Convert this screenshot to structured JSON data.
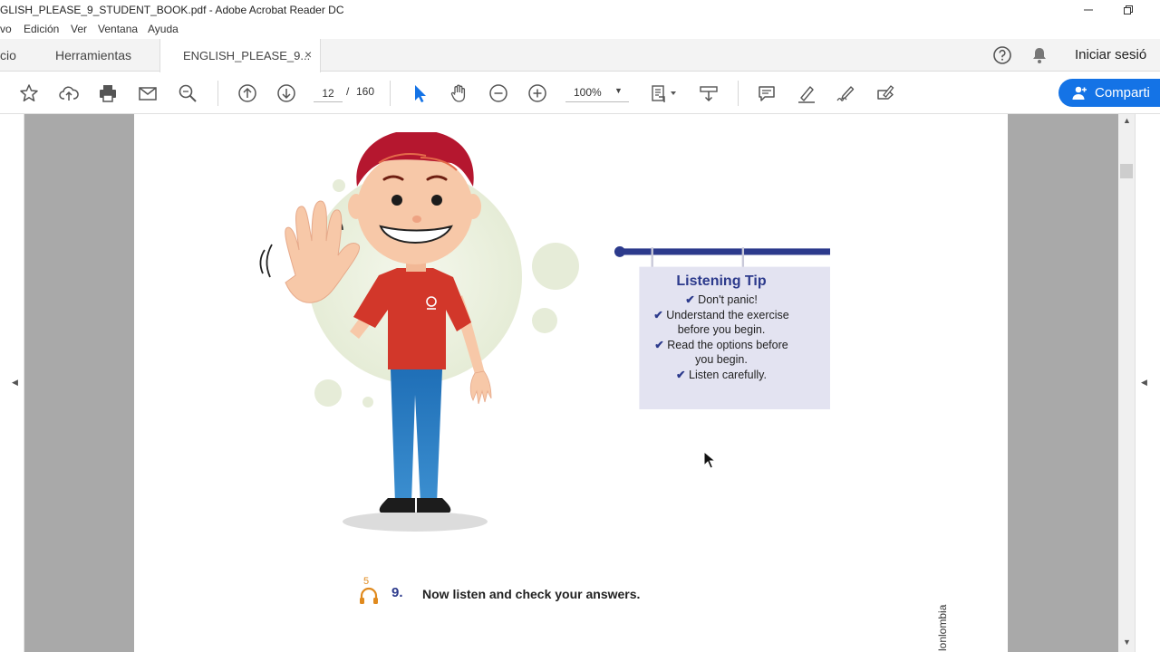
{
  "window": {
    "title": "GLISH_PLEASE_9_STUDENT_BOOK.pdf - Adobe Acrobat Reader DC"
  },
  "menu": {
    "items": [
      "vo",
      "Edición",
      "Ver",
      "Ventana",
      "Ayuda"
    ]
  },
  "tabs": {
    "home": "cio",
    "tools": "Herramientas",
    "document": "ENGLISH_PLEASE_9...",
    "close": "×"
  },
  "header": {
    "help_icon": "help-icon",
    "bell_icon": "bell-icon",
    "signin": "Iniciar sesió"
  },
  "toolbar": {
    "page_current": "12",
    "page_separator": "/",
    "page_total": "160",
    "zoom": "100%",
    "share_label": "Comparti"
  },
  "page": {
    "tip_title": "Listening Tip",
    "tip_items": [
      "Don't panic!",
      "Understand the exercise",
      "before you begin.",
      "Read the options before",
      "you begin.",
      "Listen carefully."
    ],
    "exercise_track": "5",
    "exercise_number": "9.",
    "exercise_text": "Now listen and check your answers.",
    "side_text": "lonlombia"
  },
  "colors": {
    "accent": "#1473e6",
    "tip_title": "#2c3a8c",
    "gutter": "#a9a9a9",
    "shirt": "#d2372a",
    "hair": "#b5172f"
  }
}
